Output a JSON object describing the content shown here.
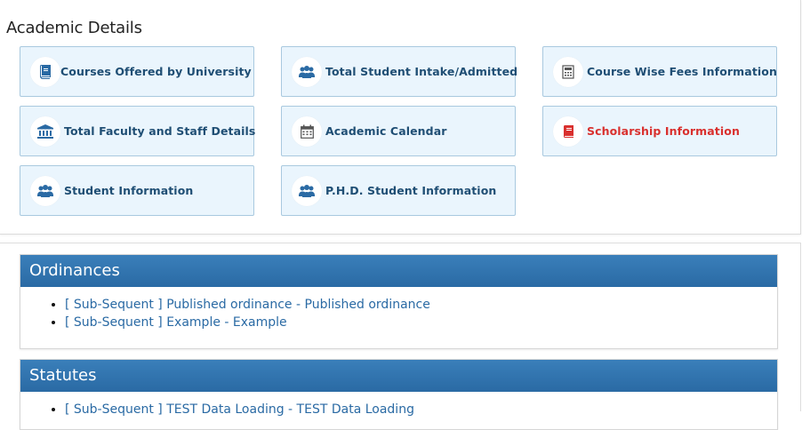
{
  "academic": {
    "title": "Academic Details",
    "tiles": [
      {
        "label": "Courses Offered by University",
        "icon": "book-icon"
      },
      {
        "label": "Total Student Intake/Admitted",
        "icon": "users-icon"
      },
      {
        "label": "Course Wise Fees Information",
        "icon": "calculator-icon"
      },
      {
        "label": "Total Faculty and Staff Details",
        "icon": "institution-icon"
      },
      {
        "label": "Academic Calendar",
        "icon": "calendar-icon"
      },
      {
        "label": "Scholarship Information",
        "icon": "book-icon"
      },
      {
        "label": "Student Information",
        "icon": "users-icon"
      },
      {
        "label": "P.H.D. Student Information",
        "icon": "users-icon"
      }
    ]
  },
  "ordinances": {
    "title": "Ordinances",
    "items": [
      "[ Sub-Sequent ] Published ordinance - Published ordinance",
      "[ Sub-Sequent ] Example - Example"
    ]
  },
  "statutes": {
    "title": "Statutes",
    "items": [
      "[ Sub-Sequent ] TEST Data Loading - TEST Data Loading"
    ]
  },
  "colors": {
    "tile_bg": "#eaf5fd",
    "tile_text": "#1f4e74",
    "highlight_text": "#d9302e",
    "header_blue": "#2a6aa4",
    "link_blue": "#2a6aa4"
  }
}
